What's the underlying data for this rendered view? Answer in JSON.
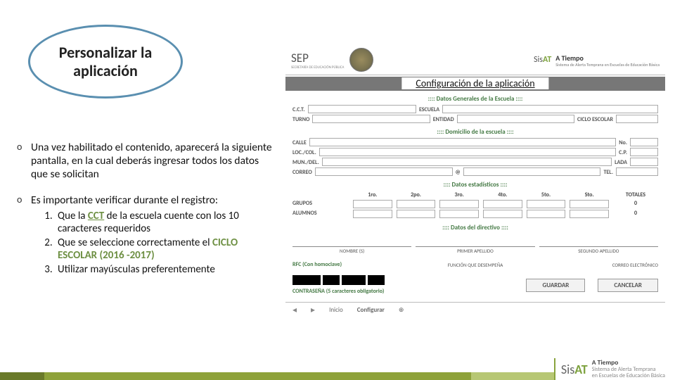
{
  "bubble_title": "Personalizar la aplicación",
  "bullets": {
    "p1": "Una vez habilitado el contenido, aparecerá la siguiente pantalla, en la cual deberás ingresar todos los datos que se solicitan",
    "p2_lead": "Es importante verificar durante el registro:",
    "li1_a": "Que la ",
    "li1_b": "CCT",
    "li1_c": " de la escuela cuente con los 10 caracteres requeridos",
    "li2_a": "Que se seleccione correctamente el ",
    "li2_b": "CICLO ESCOLAR (2016 -2017)",
    "li3": "Utilizar mayúsculas preferentemente"
  },
  "screenshot": {
    "header": {
      "sep_name": "SEP",
      "sep_sub": "SECRETARÍA DE EDUCACIÓN PÚBLICA",
      "sisat_brand_a": "Sis",
      "sisat_brand_b": "AT",
      "atiempo_l1": "A Tiempo",
      "atiempo_l2": "Sistema de Alerta Temprana en Escuelas de Educación Básica"
    },
    "panel_title": "Configuración de la aplicación",
    "section1": ":::: Datos Generales de la Escuela ::::",
    "labels": {
      "cct": "C.C.T.",
      "escuela": "ESCUELA",
      "turno": "TURNO",
      "entidad": "ENTIDAD",
      "ciclo": "CICLO ESCOLAR"
    },
    "section2": ":::: Domicilio de la escuela ::::",
    "addr": {
      "calle": "CALLE",
      "no": "No.",
      "loc": "LOC./COL.",
      "cp": "C.P.",
      "mun": "MUN./DEL.",
      "lada": "LADA",
      "correo": "CORREO",
      "at": "@",
      "tel": "TEL."
    },
    "section3": ":::: Datos estadísticos ::::",
    "stats": {
      "cols": [
        "1ro.",
        "2po.",
        "3ro.",
        "4to.",
        "5to.",
        "Sto."
      ],
      "totales": "TOTALES",
      "grupos": "GRUPOS",
      "alumnos": "ALUMNOS",
      "tot_val": "0"
    },
    "section4": ":::: Datos del directivo ::::",
    "dir": {
      "nombre": "NOMBRE (S)",
      "pap": "PRIMER APELLIDO",
      "sap": "SEGUNDO APELLIDO",
      "rfc": "RFC (Con homoclave)",
      "func": "FUNCIÓN QUE DESEMPEÑA",
      "mail": "CORREO ELECTRÓNICO",
      "pwd": "CONTRASEÑA (5 caracteres obligatorio)"
    },
    "buttons": {
      "guardar": "GUARDAR",
      "cancelar": "CANCELAR"
    },
    "footer_tabs": {
      "inicio": "Inicio",
      "config": "Configurar",
      "plus": "⊕"
    }
  },
  "footer": {
    "brand_a": "Sis",
    "brand_b": "AT",
    "l1": "A Tiempo",
    "l2": "Sistema de Alerta Temprana",
    "l3": "en Escuelas de Educación Básica"
  }
}
